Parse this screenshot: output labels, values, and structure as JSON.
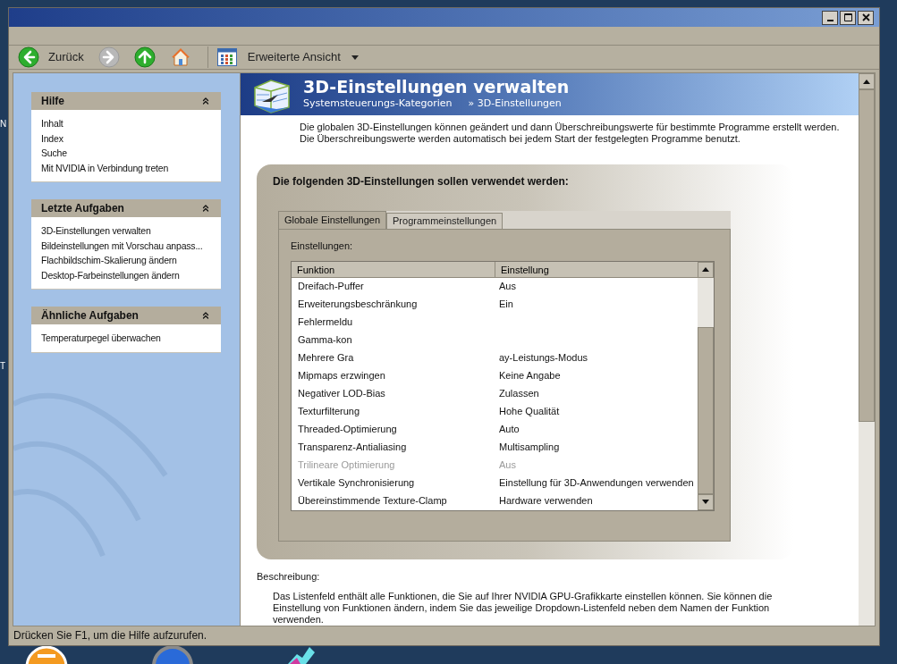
{
  "desktop": {
    "labels": [
      "N",
      "T"
    ]
  },
  "toolbar": {
    "buttons": [
      {
        "kind": "back",
        "label": "Zurück",
        "disabled": false
      },
      {
        "kind": "forward",
        "disabled": true
      },
      {
        "kind": "up",
        "disabled": false
      },
      {
        "kind": "home",
        "disabled": false
      }
    ],
    "view": {
      "label": "Erweiterte Ansicht"
    }
  },
  "sidebar": {
    "panels": [
      {
        "title": "Hilfe",
        "expanded": true,
        "items": [
          "Inhalt",
          "Index",
          "Suche",
          "Mit NVIDIA in Verbindung treten"
        ]
      },
      {
        "title": "Letzte Aufgaben",
        "expanded": true,
        "items": [
          "3D-Einstellungen verwalten",
          "Bildeinstellungen mit Vorschau anpass...",
          "Flachbildschim-Skalierung ändern",
          "Desktop-Farbeinstellungen ändern"
        ]
      },
      {
        "title": "Ähnliche Aufgaben",
        "expanded": true,
        "items": [
          "Temperaturpegel überwachen"
        ]
      }
    ]
  },
  "header": {
    "title": "3D-Einstellungen verwalten",
    "breadcrumb": [
      "Systemsteuerungs-Kategorien",
      "» 3D-Einstellungen"
    ]
  },
  "intro": "Die globalen 3D-Einstellungen können geändert und dann Überschreibungswerte für bestimmte Programme erstellt werden. Die Überschreibungswerte werden automatisch bei jedem Start der festgelegten Programme benutzt.",
  "settings": {
    "heading": "Die folgenden 3D-Einstellungen sollen verwendet werden:",
    "tabs": [
      {
        "label": "Globale Einstellungen",
        "selected": true
      },
      {
        "label": "Programmeinstellungen",
        "selected": false
      }
    ],
    "list_label": "Einstellungen:",
    "columns": [
      "Funktion",
      "Einstellung"
    ],
    "rows": [
      {
        "function": "Dreifach-Puffer",
        "setting": "Aus",
        "disabled": false
      },
      {
        "function": "Erweiterungsbeschränkung",
        "setting": "Ein",
        "disabled": false
      },
      {
        "function": "Fehlermeldu",
        "disabled": false
      },
      {
        "function": "Gamma-kon",
        "disabled": false
      },
      {
        "function": "Mehrere Gra",
        "setting": "ay-Leistungs-Modus",
        "disabled": false
      },
      {
        "function": "Mipmaps erzwingen",
        "setting": "Keine Angabe",
        "disabled": false
      },
      {
        "function": "Negativer LOD-Bias",
        "setting": "Zulassen",
        "disabled": false
      },
      {
        "function": "Texturfilterung",
        "setting": "Hohe Qualität",
        "disabled": false
      },
      {
        "function": "Threaded-Optimierung",
        "setting": "Auto",
        "disabled": false
      },
      {
        "function": "Transparenz-Antialiasing",
        "setting": "Multisampling",
        "disabled": false
      },
      {
        "function": "Trilineare Optimierung",
        "setting": "Aus",
        "disabled": true
      },
      {
        "function": "Vertikale Synchronisierung",
        "setting": "Einstellung für 3D-Anwendungen verwenden",
        "disabled": false
      },
      {
        "function": "Übereinstimmende Texture-Clamp",
        "setting": "Hardware verwenden",
        "disabled": false
      }
    ]
  },
  "description": {
    "label": "Beschreibung:",
    "text": "Das Listenfeld enthält alle Funktionen, die Sie auf Ihrer NVIDIA GPU-Grafikkarte einstellen können. Sie können die Einstellung von Funktionen ändern, indem Sie das jeweilige Dropdown-Listenfeld neben dem Namen der Funktion verwenden."
  },
  "status_bar": "Drücken Sie F1, um die Hilfe aufzurufen."
}
